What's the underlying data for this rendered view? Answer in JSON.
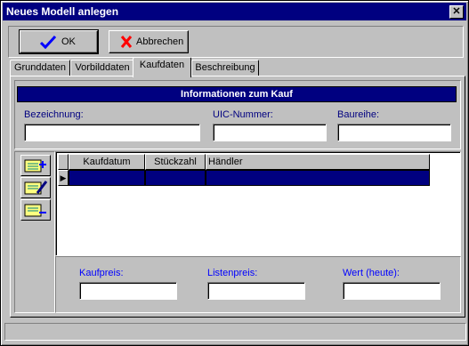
{
  "window": {
    "title": "Neues Modell anlegen"
  },
  "toolbar": {
    "ok_label": "OK",
    "cancel_label": "Abbrechen"
  },
  "tabs": [
    {
      "label": "Grunddaten",
      "active": false
    },
    {
      "label": "Vorbilddaten",
      "active": false
    },
    {
      "label": "Kaufdaten",
      "active": true
    },
    {
      "label": "Beschreibung",
      "active": false
    }
  ],
  "info": {
    "header": "Informationen zum Kauf",
    "bezeichnung_label": "Bezeichnung:",
    "bezeichnung_value": "",
    "uic_label": "UIC-Nummer:",
    "uic_value": "",
    "baureihe_label": "Baureihe:",
    "baureihe_value": ""
  },
  "grid": {
    "columns": [
      "Kaufdatum",
      "Stückzahl",
      "Händler"
    ],
    "row_indicator": "▶"
  },
  "prices": {
    "kaufpreis_label": "Kaufpreis:",
    "listenpreis_label": "Listenpreis:",
    "wert_label": "Wert (heute):"
  },
  "colors": {
    "titlebar": "#000080",
    "face": "#c0c0c0",
    "label_blue": "#000080",
    "ok_check": "#0000ff",
    "cancel_x": "#ff0000"
  },
  "icons": [
    "close-icon",
    "checkmark-icon",
    "cancel-x-icon",
    "add-record-icon",
    "edit-record-icon",
    "delete-record-icon",
    "row-indicator-icon"
  ]
}
